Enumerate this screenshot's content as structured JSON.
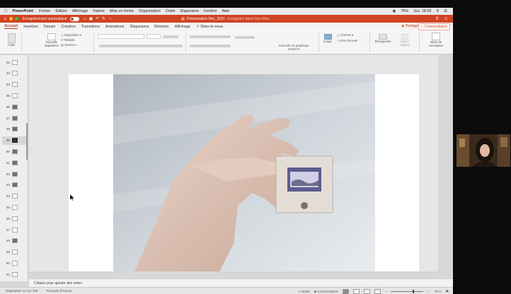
{
  "menubar": {
    "app_name": "PowerPoint",
    "items": [
      "Fichier",
      "Édition",
      "Affichage",
      "Insérer",
      "Mise en forme",
      "Organisation",
      "Outils",
      "Diaporama",
      "Fenêtre",
      "Aide"
    ],
    "battery": "75%",
    "clock": "Jeu. 18:28"
  },
  "titlebar": {
    "autosave_label": "Enregistrement automatique",
    "doc_title": "Présentation Déc_2021",
    "saved_status": "Enregistré dans mon Mac"
  },
  "tabs": {
    "items": [
      "Accueil",
      "Insertion",
      "Dessin",
      "Création",
      "Transitions",
      "Animations",
      "Diaporama",
      "Révision",
      "Affichage",
      "Dites-le-nous"
    ],
    "active": "Accueil",
    "share_label": "Partager",
    "comments_label": "Commentaires"
  },
  "ribbon": {
    "paste_label": "Coller",
    "new_slide_label": "Nouvelle diapositive",
    "layout_label": "Disposition",
    "reset_label": "Rétablir",
    "section_label": "Section",
    "convert_label": "Convertir en graphique SmartArt",
    "image_label": "Image",
    "shapes_label": "Formes",
    "textbox_label": "Zone de texte",
    "arrange_label": "Réorganiser",
    "styles_label": "Styles rapides",
    "designer_label": "Idées de conception"
  },
  "thumbnails": [
    {
      "num": "32",
      "img": false
    },
    {
      "num": "33",
      "img": false
    },
    {
      "num": "34",
      "img": false
    },
    {
      "num": "35",
      "img": false
    },
    {
      "num": "36",
      "img": true
    },
    {
      "num": "37",
      "img": true
    },
    {
      "num": "38",
      "img": true
    },
    {
      "num": "39",
      "img": true,
      "active": true
    },
    {
      "num": "40",
      "img": true
    },
    {
      "num": "41",
      "img": true
    },
    {
      "num": "42",
      "img": true
    },
    {
      "num": "43",
      "img": true
    },
    {
      "num": "44",
      "img": false
    },
    {
      "num": "45",
      "img": false
    },
    {
      "num": "46",
      "img": false
    },
    {
      "num": "47",
      "img": false
    },
    {
      "num": "48",
      "img": true
    },
    {
      "num": "49",
      "img": false
    },
    {
      "num": "50",
      "img": false
    },
    {
      "num": "51",
      "img": false
    }
  ],
  "notes": {
    "placeholder": "Cliquez pour ajouter des notes"
  },
  "status": {
    "slide_info": "Diapositive 12 sur 105",
    "language": "Français (France)",
    "notes_btn": "Notes",
    "comments_btn": "Commentaires",
    "zoom": "75 %"
  },
  "colors": {
    "accent": "#d04323",
    "titlebar_bg": "#d04323"
  }
}
